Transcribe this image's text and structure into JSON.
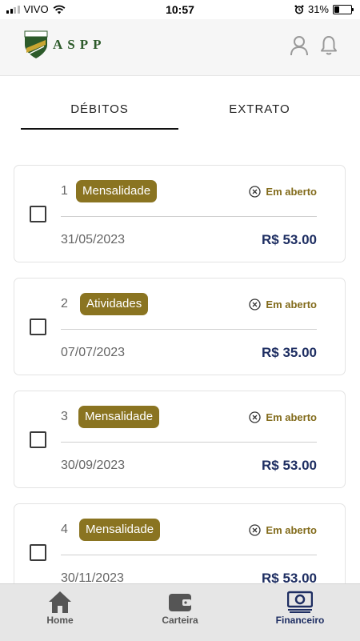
{
  "status_bar": {
    "carrier": "VIVO",
    "time": "10:57",
    "battery": "31%",
    "battery_level": 0.31
  },
  "header": {
    "logo_text": "ASPP",
    "logo_badge": "ASPP"
  },
  "tabs": [
    {
      "label": "DÉBITOS",
      "active": true
    },
    {
      "label": "EXTRATO",
      "active": false
    }
  ],
  "debts": [
    {
      "number": "1",
      "category": "Mensalidade",
      "status": "Em aberto",
      "date": "31/05/2023",
      "amount": "R$ 53.00"
    },
    {
      "number": "2",
      "category": "Atividades",
      "status": "Em aberto",
      "date": "07/07/2023",
      "amount": "R$ 35.00"
    },
    {
      "number": "3",
      "category": "Mensalidade",
      "status": "Em aberto",
      "date": "30/09/2023",
      "amount": "R$ 53.00"
    },
    {
      "number": "4",
      "category": "Mensalidade",
      "status": "Em aberto",
      "date": "30/11/2023",
      "amount": "R$ 53.00"
    }
  ],
  "bottom_nav": [
    {
      "label": "Home",
      "icon": "home-icon",
      "active": false
    },
    {
      "label": "Carteira",
      "icon": "wallet-icon",
      "active": false
    },
    {
      "label": "Financeiro",
      "icon": "money-icon",
      "active": true
    }
  ],
  "colors": {
    "accent_gold": "#8a7421",
    "amount_navy": "#1e2e62",
    "status_gold": "#826b1b"
  }
}
